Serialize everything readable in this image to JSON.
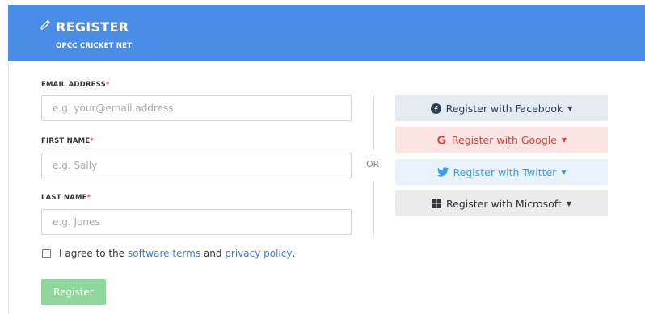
{
  "header": {
    "title": "REGISTER",
    "subtitle": "OPCC CRICKET NET",
    "icon": "pencil-icon",
    "background": "#4a8de6"
  },
  "form": {
    "email": {
      "label": "EMAIL ADDRESS",
      "required_mark": "*",
      "value": "",
      "placeholder": "e.g. your@email.address"
    },
    "first_name": {
      "label": "FIRST NAME",
      "required_mark": "*",
      "value": "",
      "placeholder": "e.g. Sally"
    },
    "last_name": {
      "label": "LAST NAME",
      "required_mark": "*",
      "value": "",
      "placeholder": "e.g. Jones"
    }
  },
  "divider": {
    "or_label": "OR"
  },
  "social": {
    "facebook": {
      "label": "Register with Facebook",
      "icon": "facebook-icon",
      "color": "#2c3e5a"
    },
    "google": {
      "label": "Register with Google",
      "icon": "google-icon",
      "color": "#d9433a"
    },
    "twitter": {
      "label": "Register with Twitter",
      "icon": "twitter-icon",
      "color": "#3aa0e8"
    },
    "microsoft": {
      "label": "Register with Microsoft",
      "icon": "microsoft-icon",
      "color": "#333333"
    }
  },
  "agreement": {
    "checked": false,
    "prefix": "I agree to the",
    "terms_link": "software terms",
    "middle": "and",
    "privacy_link": "privacy policy",
    "suffix": "."
  },
  "submit": {
    "label": "Register",
    "color": "#8fd69a"
  }
}
